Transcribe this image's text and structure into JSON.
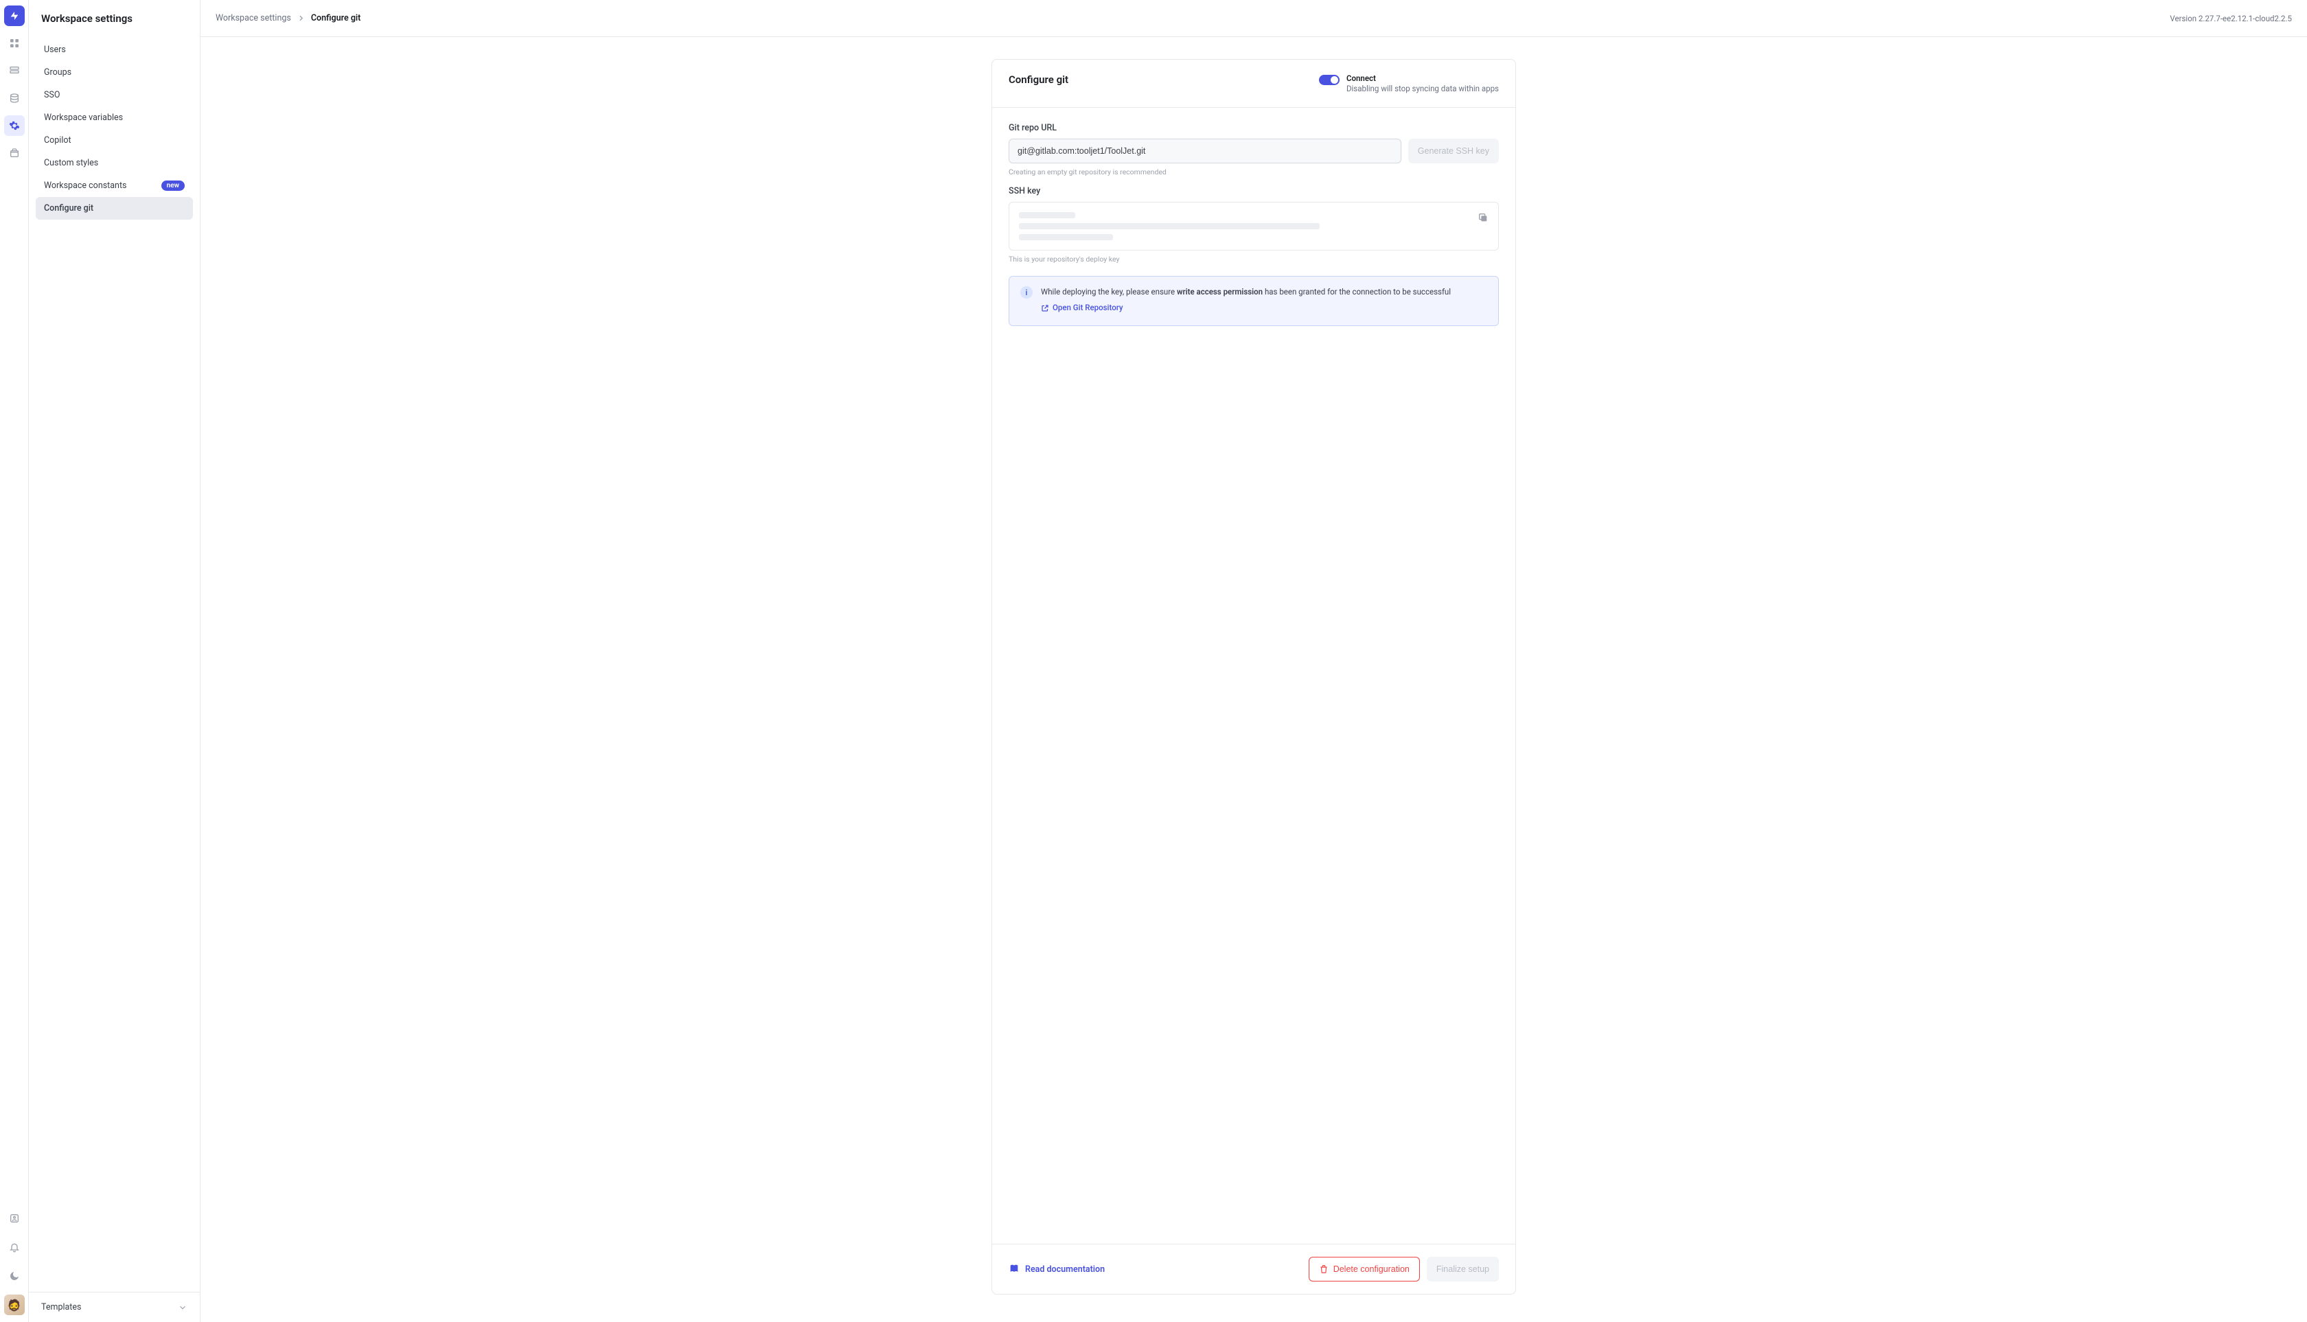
{
  "sidebar": {
    "title": "Workspace settings",
    "items": [
      {
        "label": "Users"
      },
      {
        "label": "Groups"
      },
      {
        "label": "SSO"
      },
      {
        "label": "Workspace variables"
      },
      {
        "label": "Copilot"
      },
      {
        "label": "Custom styles"
      },
      {
        "label": "Workspace constants",
        "badge": "new"
      },
      {
        "label": "Configure git",
        "selected": true
      }
    ],
    "footer_label": "Templates"
  },
  "header": {
    "breadcrumbs": {
      "root": "Workspace settings",
      "current": "Configure git"
    },
    "version": "Version 2.27.7-ee2.12.1-cloud2.2.5"
  },
  "card": {
    "title": "Configure git",
    "connect": {
      "title": "Connect",
      "subtitle": "Disabling will stop syncing data within apps",
      "enabled": true
    },
    "repo": {
      "label": "Git repo URL",
      "value": "git@gitlab.com:tooljet1/ToolJet.git",
      "generate_button": "Generate SSH key",
      "helper": "Creating an empty git repository is recommended"
    },
    "ssh": {
      "label": "SSH key",
      "helper": "This is your repository's deploy key"
    },
    "banner": {
      "text_prefix": "While deploying the key, please ensure ",
      "text_bold": "write access permission",
      "text_suffix": " has been granted for the connection to be successful",
      "link_label": "Open Git Repository"
    },
    "footer": {
      "doc_label": "Read documentation",
      "delete_label": "Delete configuration",
      "finalize_label": "Finalize setup"
    }
  }
}
